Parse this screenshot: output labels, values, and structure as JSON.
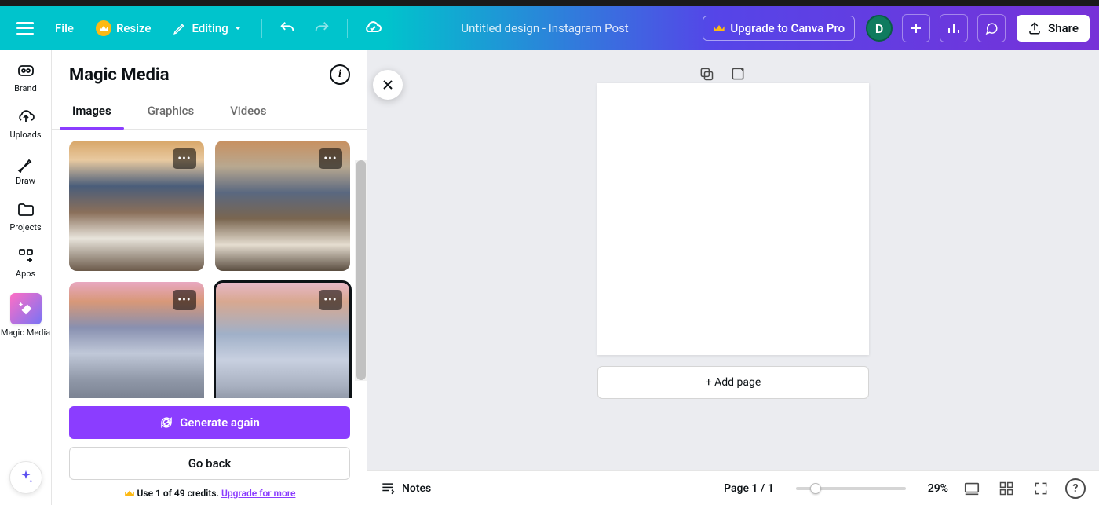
{
  "topbar": {
    "file_label": "File",
    "resize_label": "Resize",
    "editing_label": "Editing",
    "doc_title": "Untitled design - Instagram Post",
    "upgrade_label": "Upgrade to Canva Pro",
    "avatar_initial": "D",
    "share_label": "Share"
  },
  "rail": {
    "items": [
      {
        "key": "brand",
        "label": "Brand"
      },
      {
        "key": "uploads",
        "label": "Uploads"
      },
      {
        "key": "draw",
        "label": "Draw"
      },
      {
        "key": "projects",
        "label": "Projects"
      },
      {
        "key": "apps",
        "label": "Apps"
      },
      {
        "key": "magic-media",
        "label": "Magic Media"
      }
    ]
  },
  "panel": {
    "title": "Magic Media",
    "tabs": [
      {
        "key": "images",
        "label": "Images",
        "active": true
      },
      {
        "key": "graphics",
        "label": "Graphics",
        "active": false
      },
      {
        "key": "videos",
        "label": "Videos",
        "active": false
      }
    ],
    "results": [
      {
        "id": "r1",
        "selected": false
      },
      {
        "id": "r2",
        "selected": false
      },
      {
        "id": "r3",
        "selected": false
      },
      {
        "id": "r4",
        "selected": true
      }
    ],
    "generate_label": "Generate again",
    "back_label": "Go back",
    "credits_prefix": "Use 1 of 49 credits. ",
    "credits_link": "Upgrade for more"
  },
  "canvas": {
    "add_page_label": "+ Add page"
  },
  "bottombar": {
    "notes_label": "Notes",
    "page_indicator": "Page 1 / 1",
    "zoom_label": "29%"
  }
}
